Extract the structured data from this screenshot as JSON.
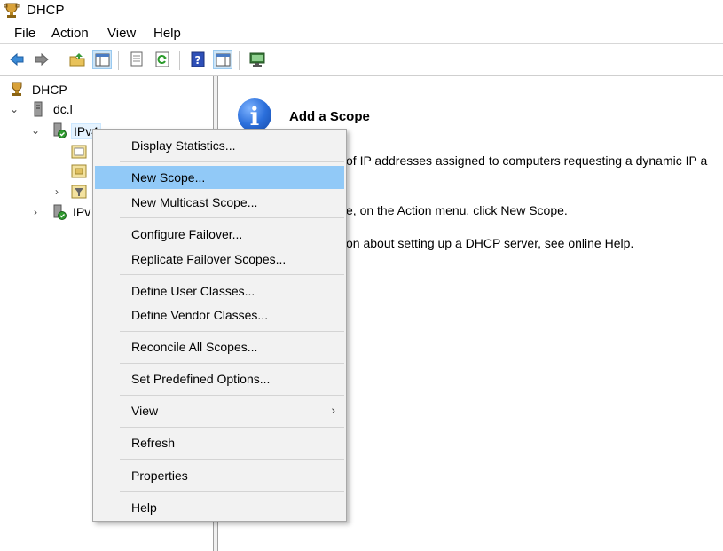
{
  "window": {
    "title": "DHCP"
  },
  "menubar": {
    "items": [
      "File",
      "Action",
      "View",
      "Help"
    ]
  },
  "toolbar": {
    "buttons": [
      {
        "name": "back-arrow-icon"
      },
      {
        "name": "forward-arrow-icon"
      },
      {
        "name": "up-folder-icon"
      },
      {
        "name": "show-hide-console-tree-icon"
      },
      {
        "name": "properties-sheet-icon"
      },
      {
        "name": "refresh-icon"
      },
      {
        "name": "help-icon"
      },
      {
        "name": "show-hide-action-pane-icon"
      },
      {
        "name": "monitor-icon"
      }
    ]
  },
  "tree": {
    "root": "DHCP",
    "server": "dc.l",
    "ipv4": "IPv4",
    "ipv6": "IPv"
  },
  "right_pane": {
    "title": "Add a Scope",
    "line1": "of IP addresses assigned to computers requesting a dynamic IP a",
    "line2": "e, on the Action menu, click New Scope.",
    "line3": "on about setting up a DHCP server, see online Help."
  },
  "context_menu": {
    "items": [
      "Display Statistics...",
      "New Scope...",
      "New Multicast Scope...",
      "Configure Failover...",
      "Replicate Failover Scopes...",
      "Define User Classes...",
      "Define Vendor Classes...",
      "Reconcile All Scopes...",
      "Set Predefined Options...",
      "View",
      "Refresh",
      "Properties",
      "Help"
    ],
    "highlighted": "New Scope...",
    "submenu_arrow": "›"
  },
  "colors": {
    "highlight": "#91c9f7",
    "menu_bg": "#f2f2f2",
    "info_blue": "#2b6fdb"
  }
}
